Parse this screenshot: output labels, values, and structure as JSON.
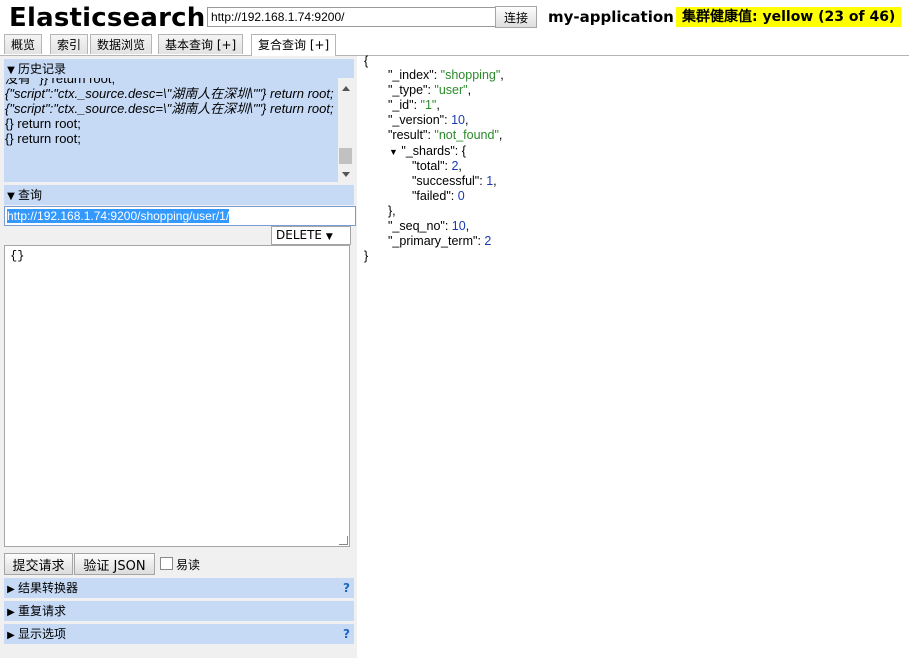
{
  "header": {
    "app_title": "Elasticsearch",
    "url_value": "http://192.168.1.74:9200/",
    "connect_label": "连接",
    "cluster_name": "my-application",
    "health_label": "集群健康值: yellow (23 of 46)",
    "health_color": "#ffff00"
  },
  "tabs": [
    {
      "label": "概览"
    },
    {
      "label": "索引"
    },
    {
      "label": "数据浏览"
    },
    {
      "label": "基本查询 [+]"
    },
    {
      "label": "复合查询 [+]",
      "active": true
    }
  ],
  "history": {
    "title": "历史记录",
    "items": [
      "没有\" }} return root;",
      "{\"script\":\"ctx._source.desc=\\\"湖南人在深圳\\\"\"} return root;",
      "{\"script\":\"ctx._source.desc=\\\"湖南人在深圳\\\"\"} return root;",
      "{} return root;",
      "{} return root;"
    ]
  },
  "query": {
    "title": "查询",
    "url": "http://192.168.1.74:9200/shopping/user/1/",
    "method": "DELETE",
    "body": "{}"
  },
  "actions": {
    "submit_label": "提交请求",
    "validate_label": "验证 JSON",
    "easy_read_label": "易读",
    "easy_read_checked": false
  },
  "panels": [
    {
      "label": "结果转换器",
      "help": "?"
    },
    {
      "label": "重复请求",
      "help": ""
    },
    {
      "label": "显示选项",
      "help": "?"
    }
  ],
  "response": {
    "open_brace": "{",
    "close_brace": "}",
    "index_key": "\"_index\"",
    "index_val": "\"shopping\"",
    "type_key": "\"_type\"",
    "type_val": "\"user\"",
    "id_key": "\"_id\"",
    "id_val": "\"1\"",
    "version_key": "\"_version\"",
    "version_val": "10",
    "result_key": "\"result\"",
    "result_val": "\"not_found\"",
    "shards_key": "\"_shards\"",
    "total_key": "\"total\"",
    "total_val": "2",
    "successful_key": "\"successful\"",
    "successful_val": "1",
    "failed_key": "\"failed\"",
    "failed_val": "0",
    "seq_no_key": "\"_seq_no\"",
    "seq_no_val": "10",
    "primary_term_key": "\"_primary_term\"",
    "primary_term_val": "2"
  }
}
